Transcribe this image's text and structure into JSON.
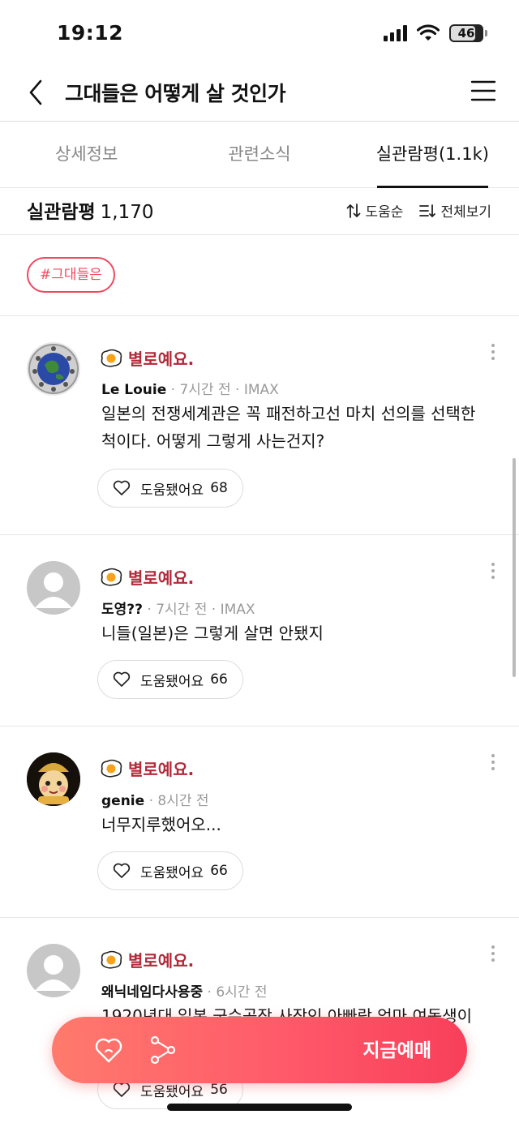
{
  "status_bar": {
    "time": "19:12",
    "battery": "46"
  },
  "nav": {
    "title": "그대들은 어떻게 살 것인가"
  },
  "tabs": [
    {
      "label": "상세정보",
      "active": false
    },
    {
      "label": "관련소식",
      "active": false
    },
    {
      "label": "실관람평(1.1k)",
      "active": true
    }
  ],
  "review_header": {
    "title": "실관람평",
    "count": "1,170",
    "sort_label": "도움순",
    "view_all_label": "전체보기"
  },
  "tag": "#그대들은",
  "reviews": [
    {
      "rating_label": "별로예요.",
      "user": "Le Louie",
      "meta": " · 7시간 전 · IMAX",
      "text": "일본의 전쟁세계관은 꼭 패전하고선 마치 선의를 선택한 척이다. 어떻게 그렇게 사는건지?",
      "helpful_label": "도움됐어요",
      "helpful_count": "68"
    },
    {
      "rating_label": "별로예요.",
      "user": "도영??",
      "meta": " · 7시간 전 · IMAX",
      "text": "니들(일본)은 그렇게 살면 안됐지",
      "helpful_label": "도움됐어요",
      "helpful_count": "66"
    },
    {
      "rating_label": "별로예요.",
      "user": "genie",
      "meta": " · 8시간 전",
      "text": "너무지루했어오...",
      "helpful_label": "도움됐어요",
      "helpful_count": "66"
    },
    {
      "rating_label": "별로예요.",
      "user": "왜닉네임다사용중",
      "meta": " · 6시간 전",
      "text": "1920년대 일본 군수공장 사장인 아빠랑 엄마 여동생이",
      "helpful_label": "도움됐어요",
      "helpful_count": "56"
    }
  ],
  "bottom_bar": {
    "cta_label": "지금예매"
  },
  "colors": {
    "accent": "#f0485e",
    "rating_text": "#b22a3a",
    "cta_gradient_start": "#ff7a6c",
    "cta_gradient_end": "#f83f5a"
  }
}
